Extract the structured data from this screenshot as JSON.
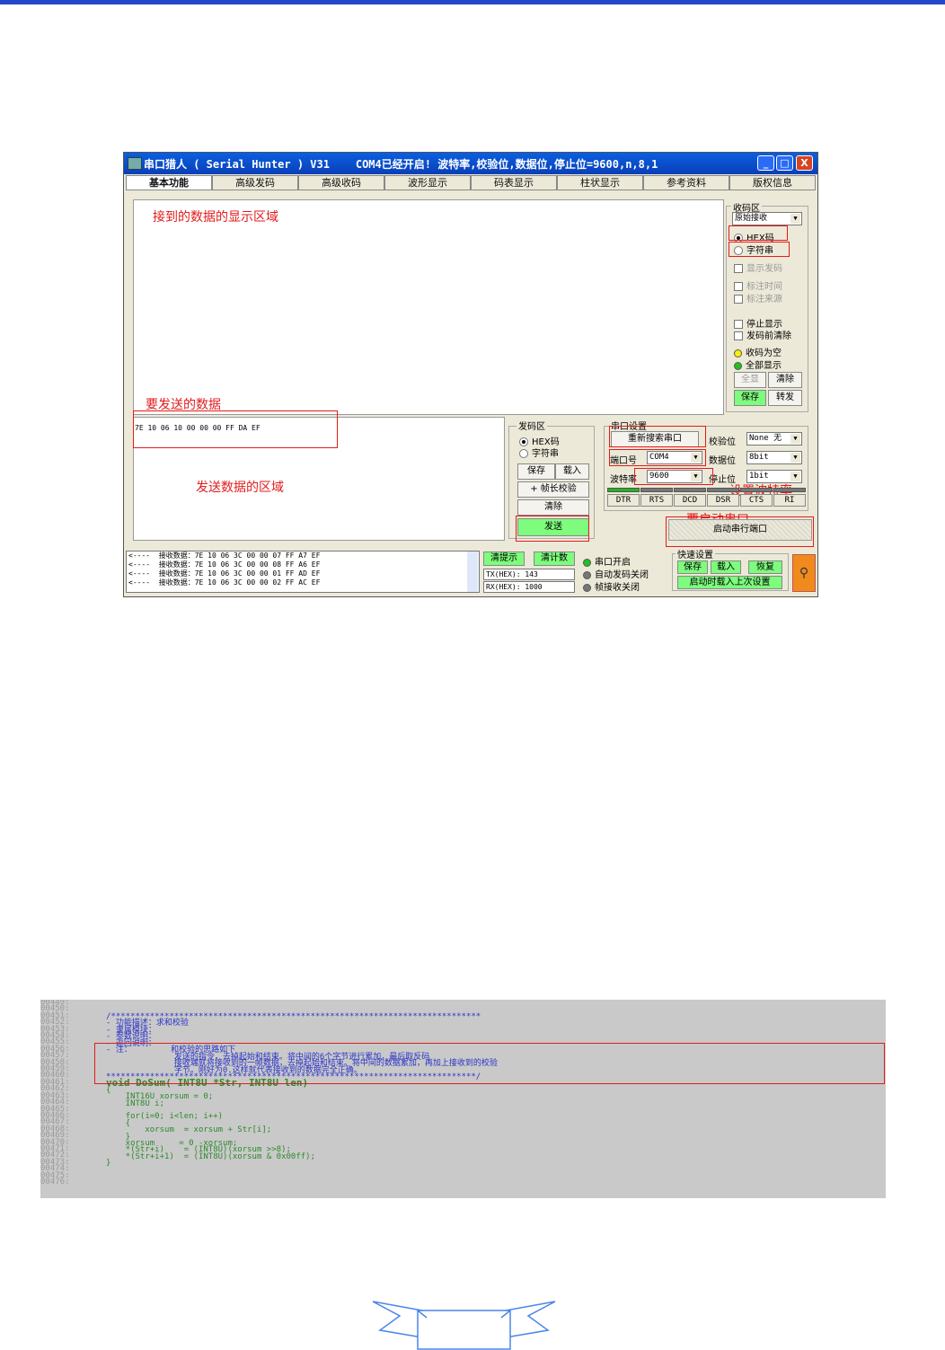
{
  "page_mark": "",
  "window": {
    "title": "串口猎人 ( Serial Hunter ) V31    COM4已经开启! 波特率,校验位,数据位,停止位=9600,n,8,1",
    "buttons": {
      "minimize": "_",
      "maximize": "□",
      "close": "X"
    },
    "tabs": [
      "基本功能",
      "高级发码",
      "高级收码",
      "波形显示",
      "码表显示",
      "柱状显示",
      "参考资料",
      "版权信息"
    ],
    "receive_panel": {
      "group_label": "收码区",
      "mode_select": "原始接收",
      "radio_hex": "HEX码",
      "radio_str": "字符串",
      "checks": [
        "显示发码",
        "标注时间",
        "标注来源",
        "停止显示",
        "发码前清除"
      ],
      "indicators": [
        "收码为空",
        "全部显示"
      ],
      "buttons": {
        "show_all": "全显",
        "clear": "清除",
        "save": "保存",
        "forward": "转发"
      }
    },
    "send_data": "7E 10 06 10 00 00 00 FF DA EF",
    "send_panel": {
      "group_label": "发码区",
      "radio_hex": "HEX码",
      "radio_str": "字符串",
      "buttons": {
        "save": "保存",
        "load": "载入",
        "checksum": "+ 帧长校验",
        "clear": "清除",
        "send": "发送"
      }
    },
    "port_settings": {
      "group_label": "串口设置",
      "rescan": "重新搜索串口",
      "parity_label": "校验位",
      "parity_value": "None 无",
      "port_label": "端口号",
      "port_value": "COM4",
      "databits_label": "数据位",
      "databits_value": "8bit",
      "baud_label": "波特率",
      "baud_value": "9600",
      "stopbits_label": "停止位",
      "stopbits_value": "1bit",
      "signals": [
        "DTR",
        "RTS",
        "DCD",
        "DSR",
        "CTS",
        "RI"
      ],
      "start": "启动串行端口"
    },
    "log_lines": [
      "<----  接收数据：7E 10 06 3C 00 00 07 FF A7 EF",
      "<----  接收数据：7E 10 06 3C 00 00 08 FF A6 EF",
      "<----  接收数据：7E 10 06 3C 00 00 01 FF AD EF",
      "<----  接收数据：7E 10 06 3C 00 00 02 FF AC EF"
    ],
    "status": {
      "clear_hint": "清提示",
      "clear_count": "清计数",
      "tx": "TX(HEX): 143",
      "rx": "RX(HEX): 1000",
      "port_open": "串口开启",
      "auto_send_off": "自动发码关闭",
      "frame_recv_off": "帧接收关闭"
    },
    "quick_settings": {
      "group_label": "快速设置",
      "save": "保存",
      "load": "载入",
      "restore": "恢复",
      "load_last": "启动时载入上次设置"
    }
  },
  "annotations": {
    "recv_area": "接到的数据的显示区域",
    "send_data": "要发送的数据",
    "send_area": "发送数据的区域",
    "baud": "设置波特率",
    "start_port": "要启动串口"
  },
  "code": {
    "line_numbers": [
      "00449:",
      "00450:",
      "00451:",
      "00452:",
      "00453:",
      "00454:",
      "00455:",
      "00456:",
      "00457:",
      "00458:",
      "00459:",
      "00460:",
      "00461:",
      "00462:",
      "00463:",
      "00464:",
      "00465:",
      "00466:",
      "00467:",
      "00468:",
      "00469:",
      "00470:",
      "00471:",
      "00472:",
      "00473:",
      "00474:",
      "00475:",
      "00476:"
    ],
    "lines": [
      "/****************************************************************************",
      "- 功能描述：求和校验",
      "- 隶属模块：",
      "- 参数说明：",
      "- 返回说明：",
      "- 注：        和校验的思路如下",
      "              发送的指令，去掉起始和结束。将中间的6个字节进行累加，最后取反码",
      "              接收端就将接收到的一帧数据，去掉起始和结束。将中间的数据累加，再加上接收到的校验",
      "              字节。刚好为0.这样就代表接收到的数据完全正确。",
      "****************************************************************************/",
      "void DoSum( INT8U *Str, INT8U len)",
      "{",
      "    INT16U xorsum = 0;",
      "    INT8U i;",
      "",
      "    for(i=0; i<len; i++)",
      "    {",
      "        xorsum  = xorsum + Str[i];",
      "    }",
      "    xorsum     = 0 -xorsum;",
      "    *(Str+i)    = (INT8U)(xorsum >>8);",
      "    *(Str+i+1)  = (INT8U)(xorsum & 0x00ff);",
      "}"
    ],
    "func_name": "DoSum"
  },
  "colors": {
    "accent_blue": "#2447c9",
    "annotation_red": "#e31b1b",
    "code_comment": "#2b34c9",
    "code_keyword": "#2b8a2b",
    "button_green": "#7dfc7d"
  }
}
